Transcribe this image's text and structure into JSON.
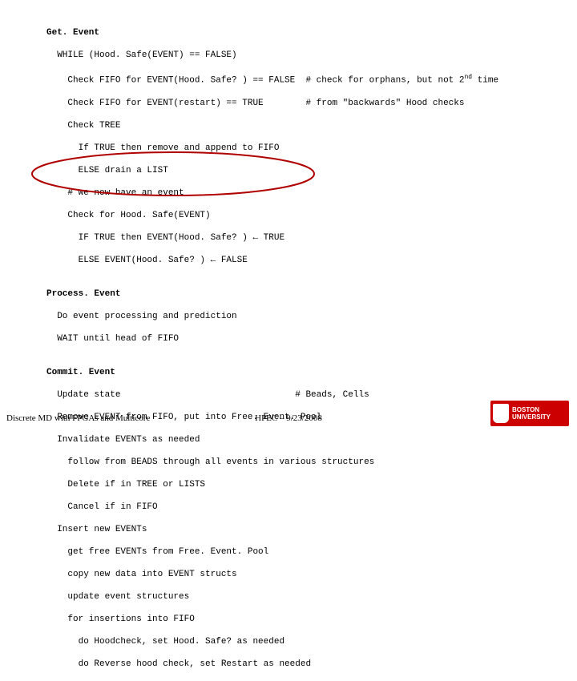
{
  "getEvent": {
    "title": "Get. Event",
    "l1": "  WHILE (Hood. Safe(EVENT) == FALSE)",
    "l2a": "    Check FIFO for EVENT(Hood. Safe? ) == FALSE  # check for orphans, but not 2",
    "l2sup": "nd",
    "l2b": " time",
    "l3": "    Check FIFO for EVENT(restart) == TRUE        # from \"backwards\" Hood checks",
    "l4": "    Check TREE",
    "l5": "      If TRUE then remove and append to FIFO",
    "l6": "      ELSE drain a LIST",
    "l7": "    # we now have an event",
    "l8": "    Check for Hood. Safe(EVENT)",
    "l9": "      IF TRUE then EVENT(Hood. Safe? ) ← TRUE",
    "l10": "      ELSE EVENT(Hood. Safe? ) ← FALSE"
  },
  "processEvent": {
    "title": "Process. Event",
    "l1": "  Do event processing and prediction",
    "l2": "  WAIT until head of FIFO"
  },
  "commitEvent": {
    "title": "Commit. Event",
    "l1": "  Update state                                 # Beads, Cells",
    "l2": "  Remove EVENT from FIFO, put into Free. Event. Pool",
    "l3": "  Invalidate EVENTs as needed",
    "l4": "    follow from BEADS through all events in various structures",
    "l5": "    Delete if in TREE or LISTS",
    "l6": "    Cancel if in FIFO",
    "l7": "  Insert new EVENTs",
    "l8": "    get free EVENTs from Free. Event. Pool",
    "l9": "    copy new data into EVENT structs",
    "l10": "    update event structures",
    "l11": "    for insertions into FIFO",
    "l12": "      do Hoodcheck, set Hood. Safe? as needed",
    "l13": "      do Reverse hood check, set Restart as needed"
  },
  "footer": {
    "left": "Discrete MD with FPGAs and Multicore",
    "center": "HPEC – 9/23/2008"
  },
  "logo": {
    "line1": "BOSTON",
    "line2": "UNIVERSITY"
  }
}
